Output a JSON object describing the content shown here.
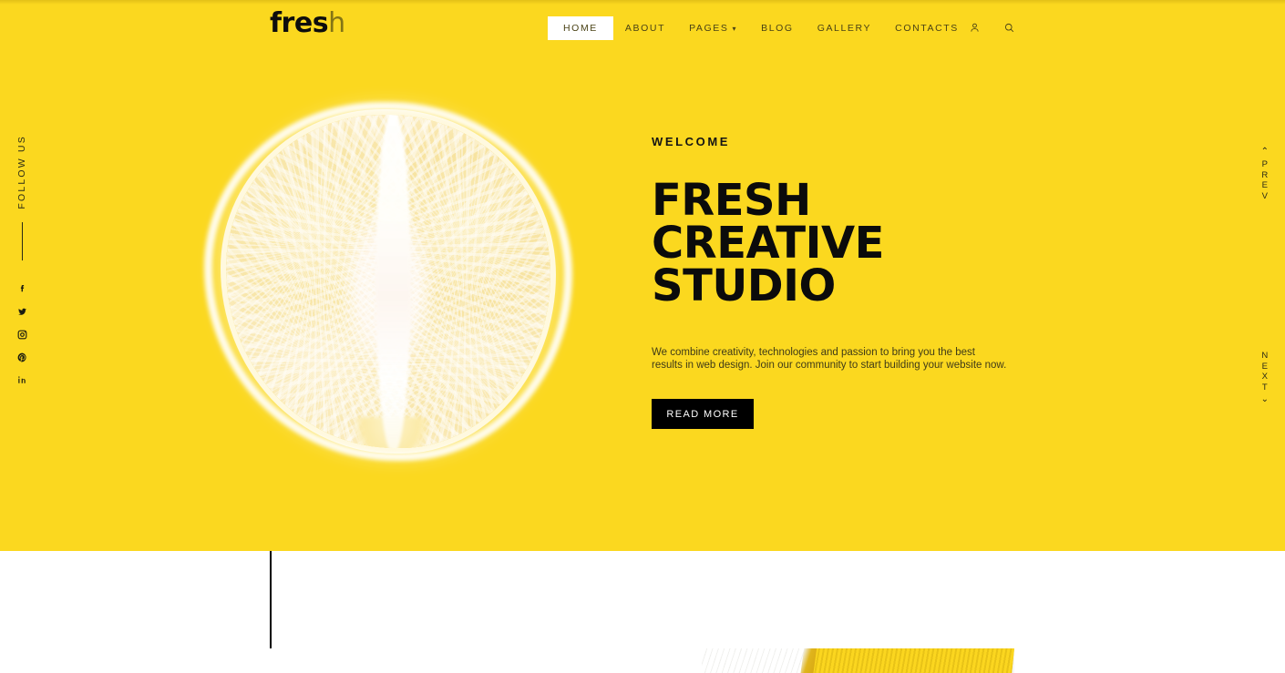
{
  "site": {
    "logo_bold": "fres",
    "logo_light": "h",
    "logo_full": "fresh"
  },
  "header": {
    "nav_items": [
      {
        "label": "HOME",
        "active": true,
        "has_caret": false
      },
      {
        "label": "ABOUT",
        "active": false,
        "has_caret": false
      },
      {
        "label": "PAGES",
        "active": false,
        "has_caret": true
      },
      {
        "label": "BLOG",
        "active": false,
        "has_caret": false
      },
      {
        "label": "GALLERY",
        "active": false,
        "has_caret": false
      },
      {
        "label": "CONTACTS",
        "active": false,
        "has_caret": false
      }
    ],
    "caret_glyph": "▾",
    "icons": [
      {
        "name": "user-icon",
        "title": "Account"
      },
      {
        "name": "search-icon",
        "title": "Search"
      }
    ]
  },
  "social": {
    "label": "FOLLOW US",
    "links": [
      {
        "name": "facebook-icon",
        "title": "Facebook"
      },
      {
        "name": "twitter-icon",
        "title": "Twitter"
      },
      {
        "name": "instagram-icon",
        "title": "Instagram"
      },
      {
        "name": "pinterest-icon",
        "title": "Pinterest"
      },
      {
        "name": "linkedin-icon",
        "title": "LinkedIn"
      }
    ]
  },
  "hero": {
    "eyebrow": "WELCOME",
    "title_line1": "FRESH",
    "title_line2": "CREATIVE",
    "title_line3": "STUDIO",
    "description": "We combine creativity, technologies and passion to bring you the best results in web design. Join our community to start building your website now.",
    "cta_label": "READ MORE",
    "image_alt": "halved citrus fruit on yellow background"
  },
  "slider": {
    "prev_label": "PREV",
    "next_label": "NEXT",
    "prev_chevron": "⌃",
    "next_chevron": "⌄"
  },
  "colors": {
    "brand_yellow": "#fbd81f",
    "top_band": "#e3c117",
    "ink": "#0b0b0b",
    "muted_ink": "#4a4215",
    "cta_bg": "#000000",
    "cta_text": "#ffffff",
    "page_bg": "#ffffff"
  }
}
